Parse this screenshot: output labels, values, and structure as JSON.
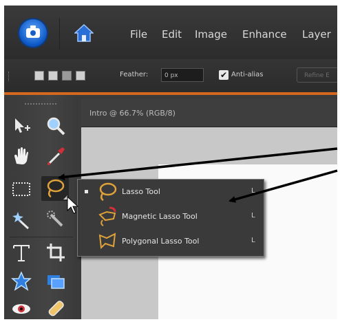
{
  "menubar": {
    "items": [
      "File",
      "Edit",
      "Image",
      "Enhance",
      "Layer"
    ]
  },
  "options": {
    "feather_label": "Feather:",
    "feather_value": "0 px",
    "antialias_label": "Anti-alias",
    "antialias_checked": true,
    "refine_label": "Refine E"
  },
  "document": {
    "tab_title": "Intro @ 66.7% (RGB/8)"
  },
  "flyout": {
    "items": [
      {
        "label": "Lasso Tool",
        "shortcut": "L",
        "active": true
      },
      {
        "label": "Magnetic Lasso Tool",
        "shortcut": "L",
        "active": false
      },
      {
        "label": "Polygonal Lasso Tool",
        "shortcut": "L",
        "active": false
      }
    ]
  },
  "colors": {
    "accent_orange": "#d2691e",
    "brand_blue": "#0b55c4",
    "lasso_icon": "#e0a23a"
  },
  "icons": {
    "toolbox": [
      "move-icon",
      "zoom-icon",
      "hand-icon",
      "eyedropper-icon",
      "marquee-icon",
      "lasso-icon",
      "magic-wand-icon",
      "quick-selection-icon",
      "type-icon",
      "crop-icon",
      "shape-icon",
      "recompose-icon",
      "red-eye-icon",
      "healing-icon"
    ]
  }
}
